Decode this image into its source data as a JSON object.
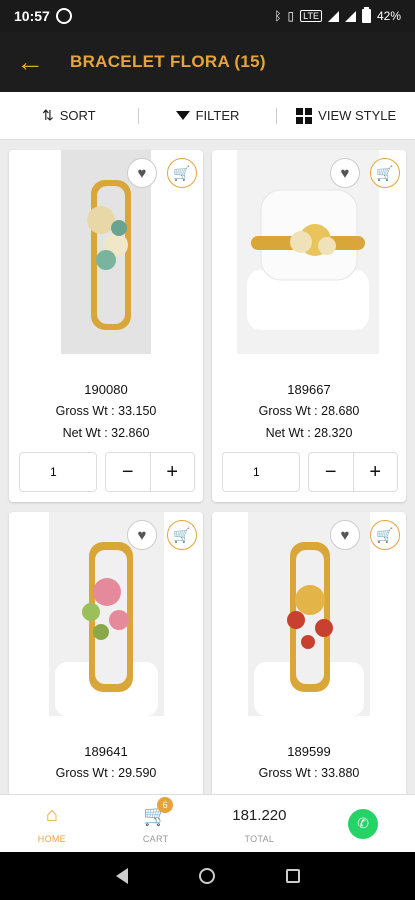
{
  "status": {
    "time": "10:57",
    "battery": "42%",
    "network": "LTE"
  },
  "header": {
    "title": "BRACELET FLORA  (15)"
  },
  "toolbar": {
    "sort": "SORT",
    "filter": "FILTER",
    "view_style": "VIEW STYLE"
  },
  "products": [
    {
      "code": "190080",
      "gross": "Gross Wt : 33.150",
      "net": "Net Wt : 32.860",
      "qty": "1"
    },
    {
      "code": "189667",
      "gross": "Gross Wt : 28.680",
      "net": "Net Wt : 28.320",
      "qty": "1"
    },
    {
      "code": "189641",
      "gross": "Gross Wt : 29.590",
      "net": "",
      "qty": ""
    },
    {
      "code": "189599",
      "gross": "Gross Wt : 33.880",
      "net": "",
      "qty": ""
    }
  ],
  "bottom_nav": {
    "home": "HOME",
    "cart": "CART",
    "cart_count": "6",
    "total_value": "181.220",
    "total": "TOTAL"
  },
  "colors": {
    "accent": "#e6a33a",
    "appbar": "#1d1d1d",
    "whatsapp": "#25d366"
  }
}
